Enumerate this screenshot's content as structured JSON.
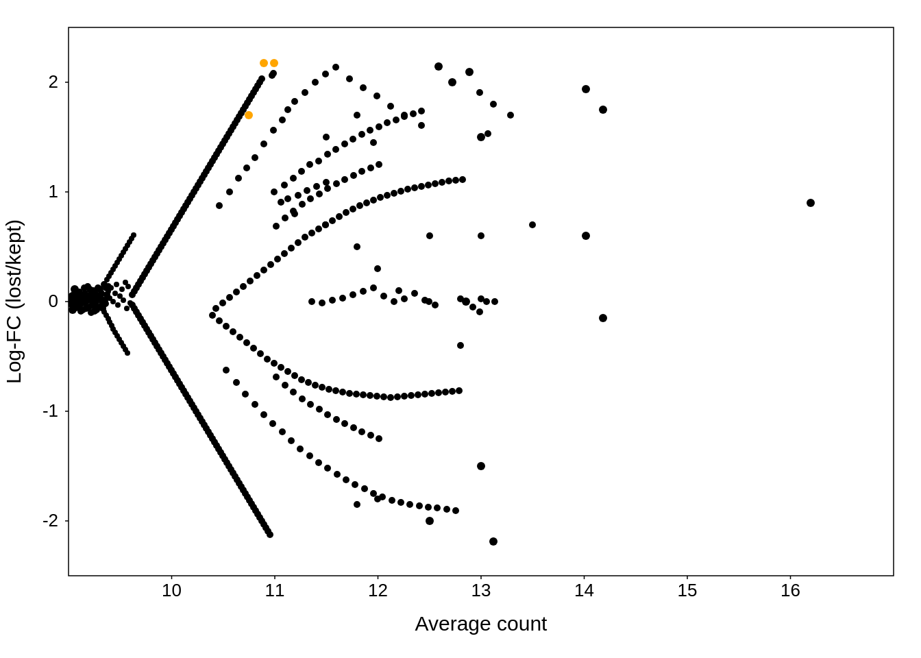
{
  "chart": {
    "title": "",
    "x_axis_label": "Average count",
    "y_axis_label": "Log-FC (lost/kept)",
    "x_min": 9,
    "x_max": 17,
    "y_min": -2.5,
    "y_max": 2.5,
    "x_ticks": [
      10,
      11,
      12,
      13,
      14,
      15,
      16
    ],
    "y_ticks": [
      -2,
      -1,
      0,
      1,
      2
    ],
    "background": "#ffffff",
    "plot_background": "#ffffff",
    "border_color": "#000000"
  }
}
